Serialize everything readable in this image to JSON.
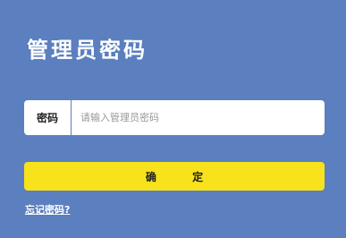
{
  "page": {
    "title": "管理员密码"
  },
  "password": {
    "label": "密码",
    "placeholder": "请输入管理员密码",
    "value": ""
  },
  "confirm_button": {
    "label": "确 定"
  },
  "forgot_link": {
    "label": "忘记密码?"
  },
  "colors": {
    "background": "#5b7fbf",
    "button": "#f7e21c",
    "input_bg": "#ffffff",
    "title": "#ffffff"
  }
}
